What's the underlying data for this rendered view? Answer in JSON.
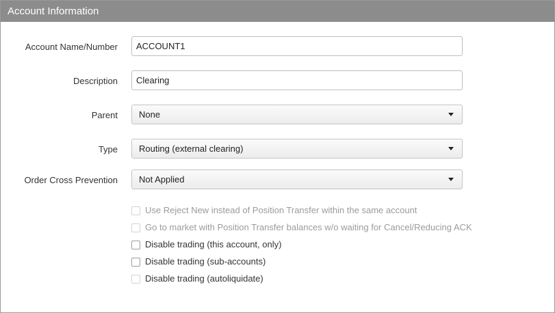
{
  "panel": {
    "title": "Account Information"
  },
  "fields": {
    "account_name": {
      "label": "Account Name/Number",
      "value": "ACCOUNT1"
    },
    "description": {
      "label": "Description",
      "value": "Clearing"
    },
    "parent": {
      "label": "Parent",
      "value": "None"
    },
    "type": {
      "label": "Type",
      "value": "Routing (external clearing)"
    },
    "order_cross_prevention": {
      "label": "Order Cross Prevention",
      "value": "Not Applied"
    }
  },
  "options": [
    {
      "label": "Use Reject New instead of Position Transfer within the same account",
      "checked": false,
      "disabled": true
    },
    {
      "label": "Go to market with Position Transfer balances w/o waiting for Cancel/Reducing ACK",
      "checked": false,
      "disabled": true
    },
    {
      "label": "Disable trading (this account, only)",
      "checked": false,
      "disabled": false
    },
    {
      "label": "Disable trading (sub-accounts)",
      "checked": false,
      "disabled": false
    },
    {
      "label": "Disable trading (autoliquidate)",
      "checked": false,
      "disabled": true
    }
  ],
  "colors": {
    "header_bg": "#8c8c8c",
    "disabled_text": "#9b9b9b"
  },
  "icons": {
    "dropdown": "chevron-down-icon"
  }
}
